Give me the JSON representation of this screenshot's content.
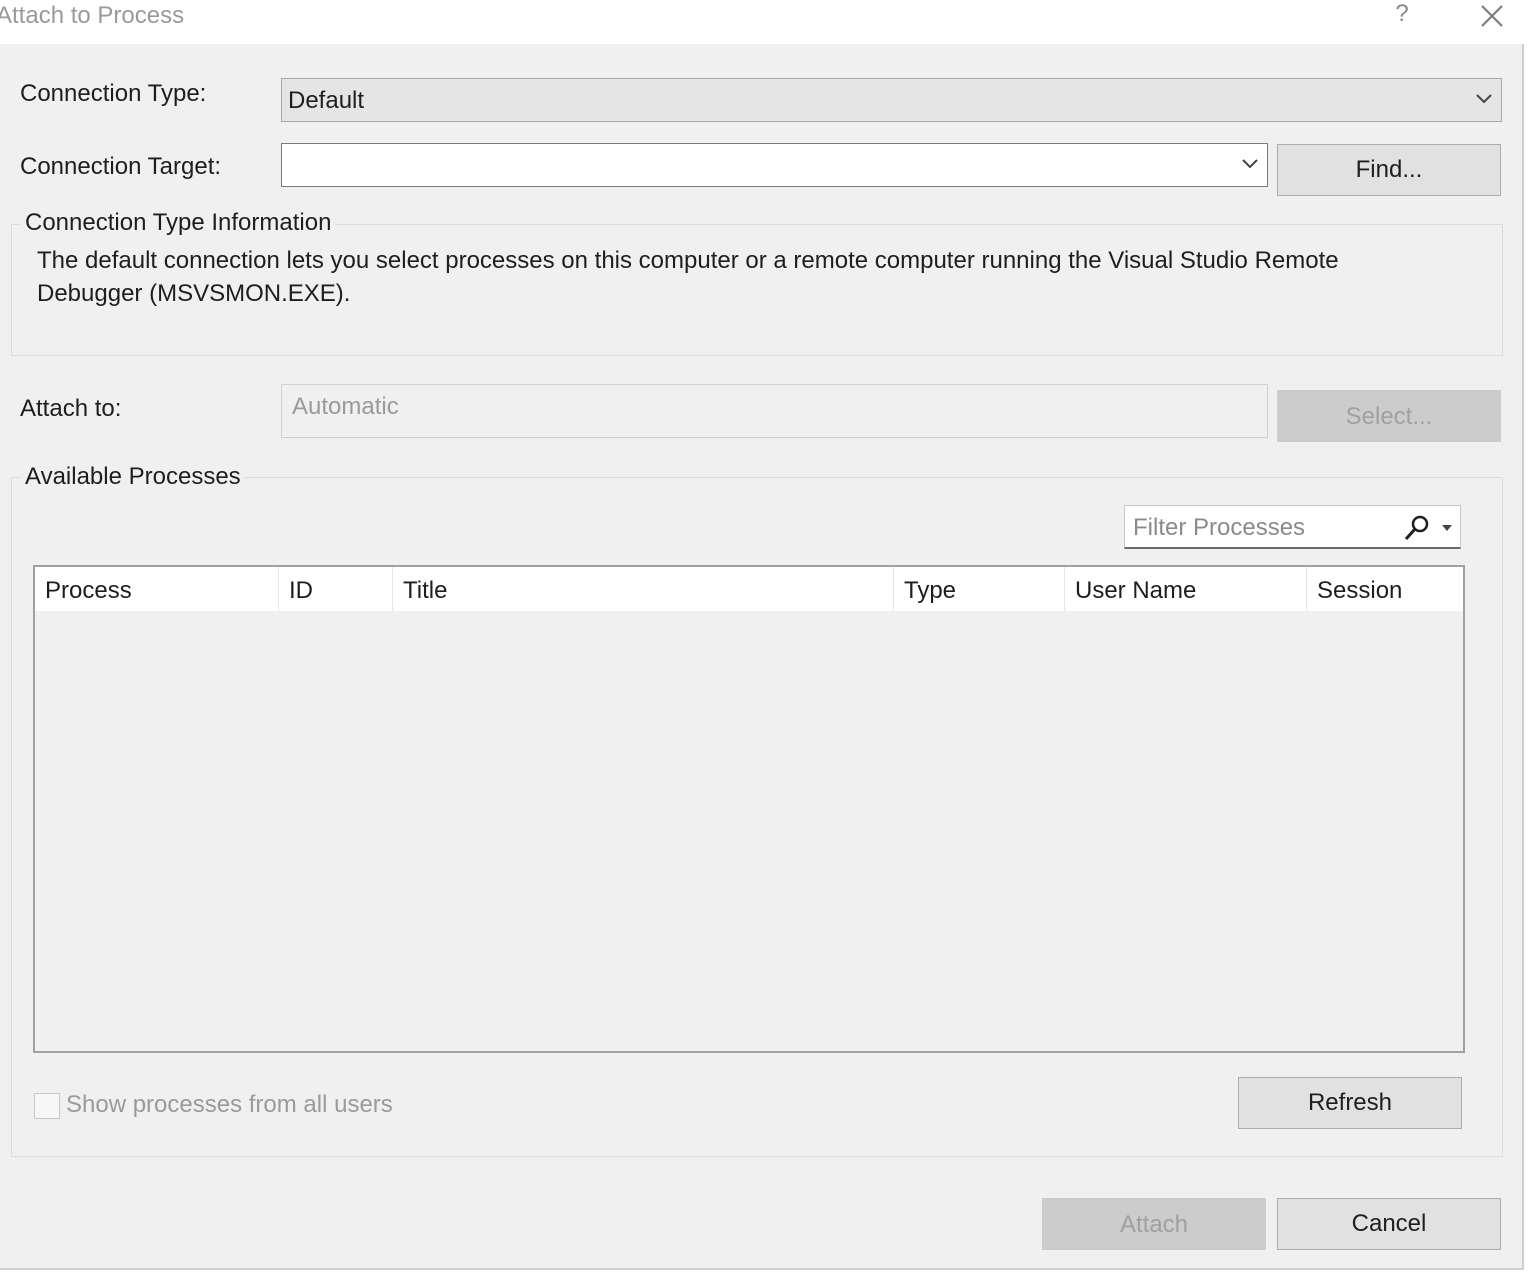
{
  "window": {
    "title": "Attach to Process",
    "help_label": "?"
  },
  "connection_type": {
    "label": "Connection Type:",
    "value": "Default"
  },
  "connection_target": {
    "label": "Connection Target:",
    "value": "",
    "find_button": "Find..."
  },
  "info_group": {
    "title": "Connection Type Information",
    "text": "The default connection lets you select processes on this computer or a remote computer running the Visual Studio Remote Debugger (MSVSMON.EXE)."
  },
  "attach_to": {
    "label": "Attach to:",
    "value": "Automatic",
    "select_button": "Select..."
  },
  "processes_group": {
    "title": "Available Processes",
    "filter_placeholder": "Filter Processes",
    "columns": [
      "Process",
      "ID",
      "Title",
      "Type",
      "User Name",
      "Session"
    ],
    "rows": [],
    "show_all_users_label": "Show processes from all users",
    "show_all_users_checked": false,
    "refresh_button": "Refresh"
  },
  "footer": {
    "attach_button": "Attach",
    "cancel_button": "Cancel"
  },
  "icons": {
    "close": "close-icon",
    "chevron": "chevron-down-icon",
    "search": "search-icon",
    "dropdown": "dropdown-arrow-icon"
  }
}
